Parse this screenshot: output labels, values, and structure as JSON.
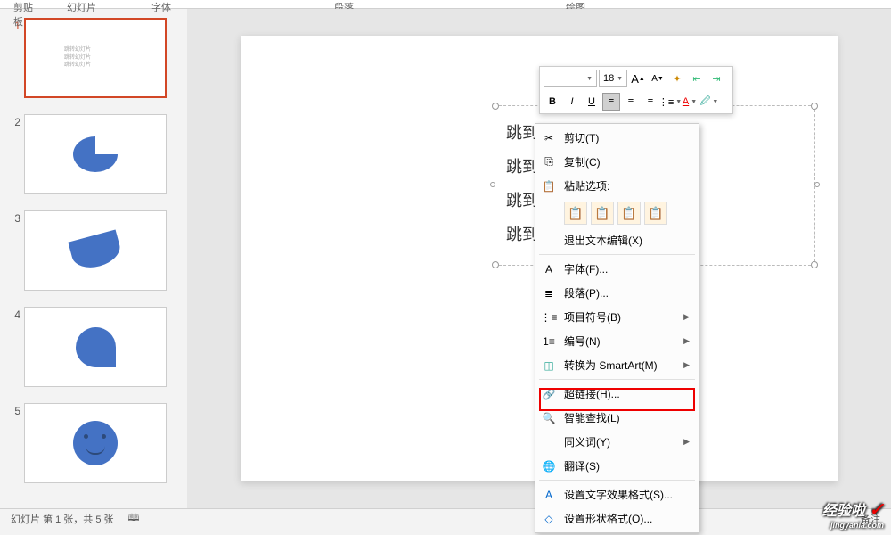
{
  "ribbon": {
    "clipboard": "剪贴板",
    "slides": "幻灯片",
    "font": "字体",
    "paragraph": "段落",
    "drawing": "绘图"
  },
  "thumbs": {
    "nums": [
      "1",
      "2",
      "3",
      "4",
      "5"
    ],
    "textsample": "跳转幻灯片"
  },
  "mini_toolbar": {
    "font_size": "18",
    "bold": "B",
    "italic": "I",
    "underline": "U",
    "a_large": "A",
    "a_small": "A"
  },
  "textbox": {
    "l1": "跳到",
    "l2": "跳到",
    "l3": "跳到",
    "l4": "跳到"
  },
  "context_menu": {
    "cut": "剪切(T)",
    "copy": "复制(C)",
    "paste_label": "粘贴选项:",
    "exit_text": "退出文本编辑(X)",
    "font": "字体(F)...",
    "paragraph": "段落(P)...",
    "bullets": "项目符号(B)",
    "numbering": "编号(N)",
    "smartart": "转换为 SmartArt(M)",
    "hyperlink": "超链接(H)...",
    "smart_lookup": "智能查找(L)",
    "synonyms": "同义词(Y)",
    "translate": "翻译(S)",
    "text_effects": "设置文字效果格式(S)...",
    "shape_format": "设置形状格式(O)..."
  },
  "status": {
    "slide_info": "幻灯片 第 1 张，共 5 张",
    "notes_icon": "备注"
  },
  "watermark": {
    "main": "经验啦",
    "sub": "jingyanla.com"
  }
}
